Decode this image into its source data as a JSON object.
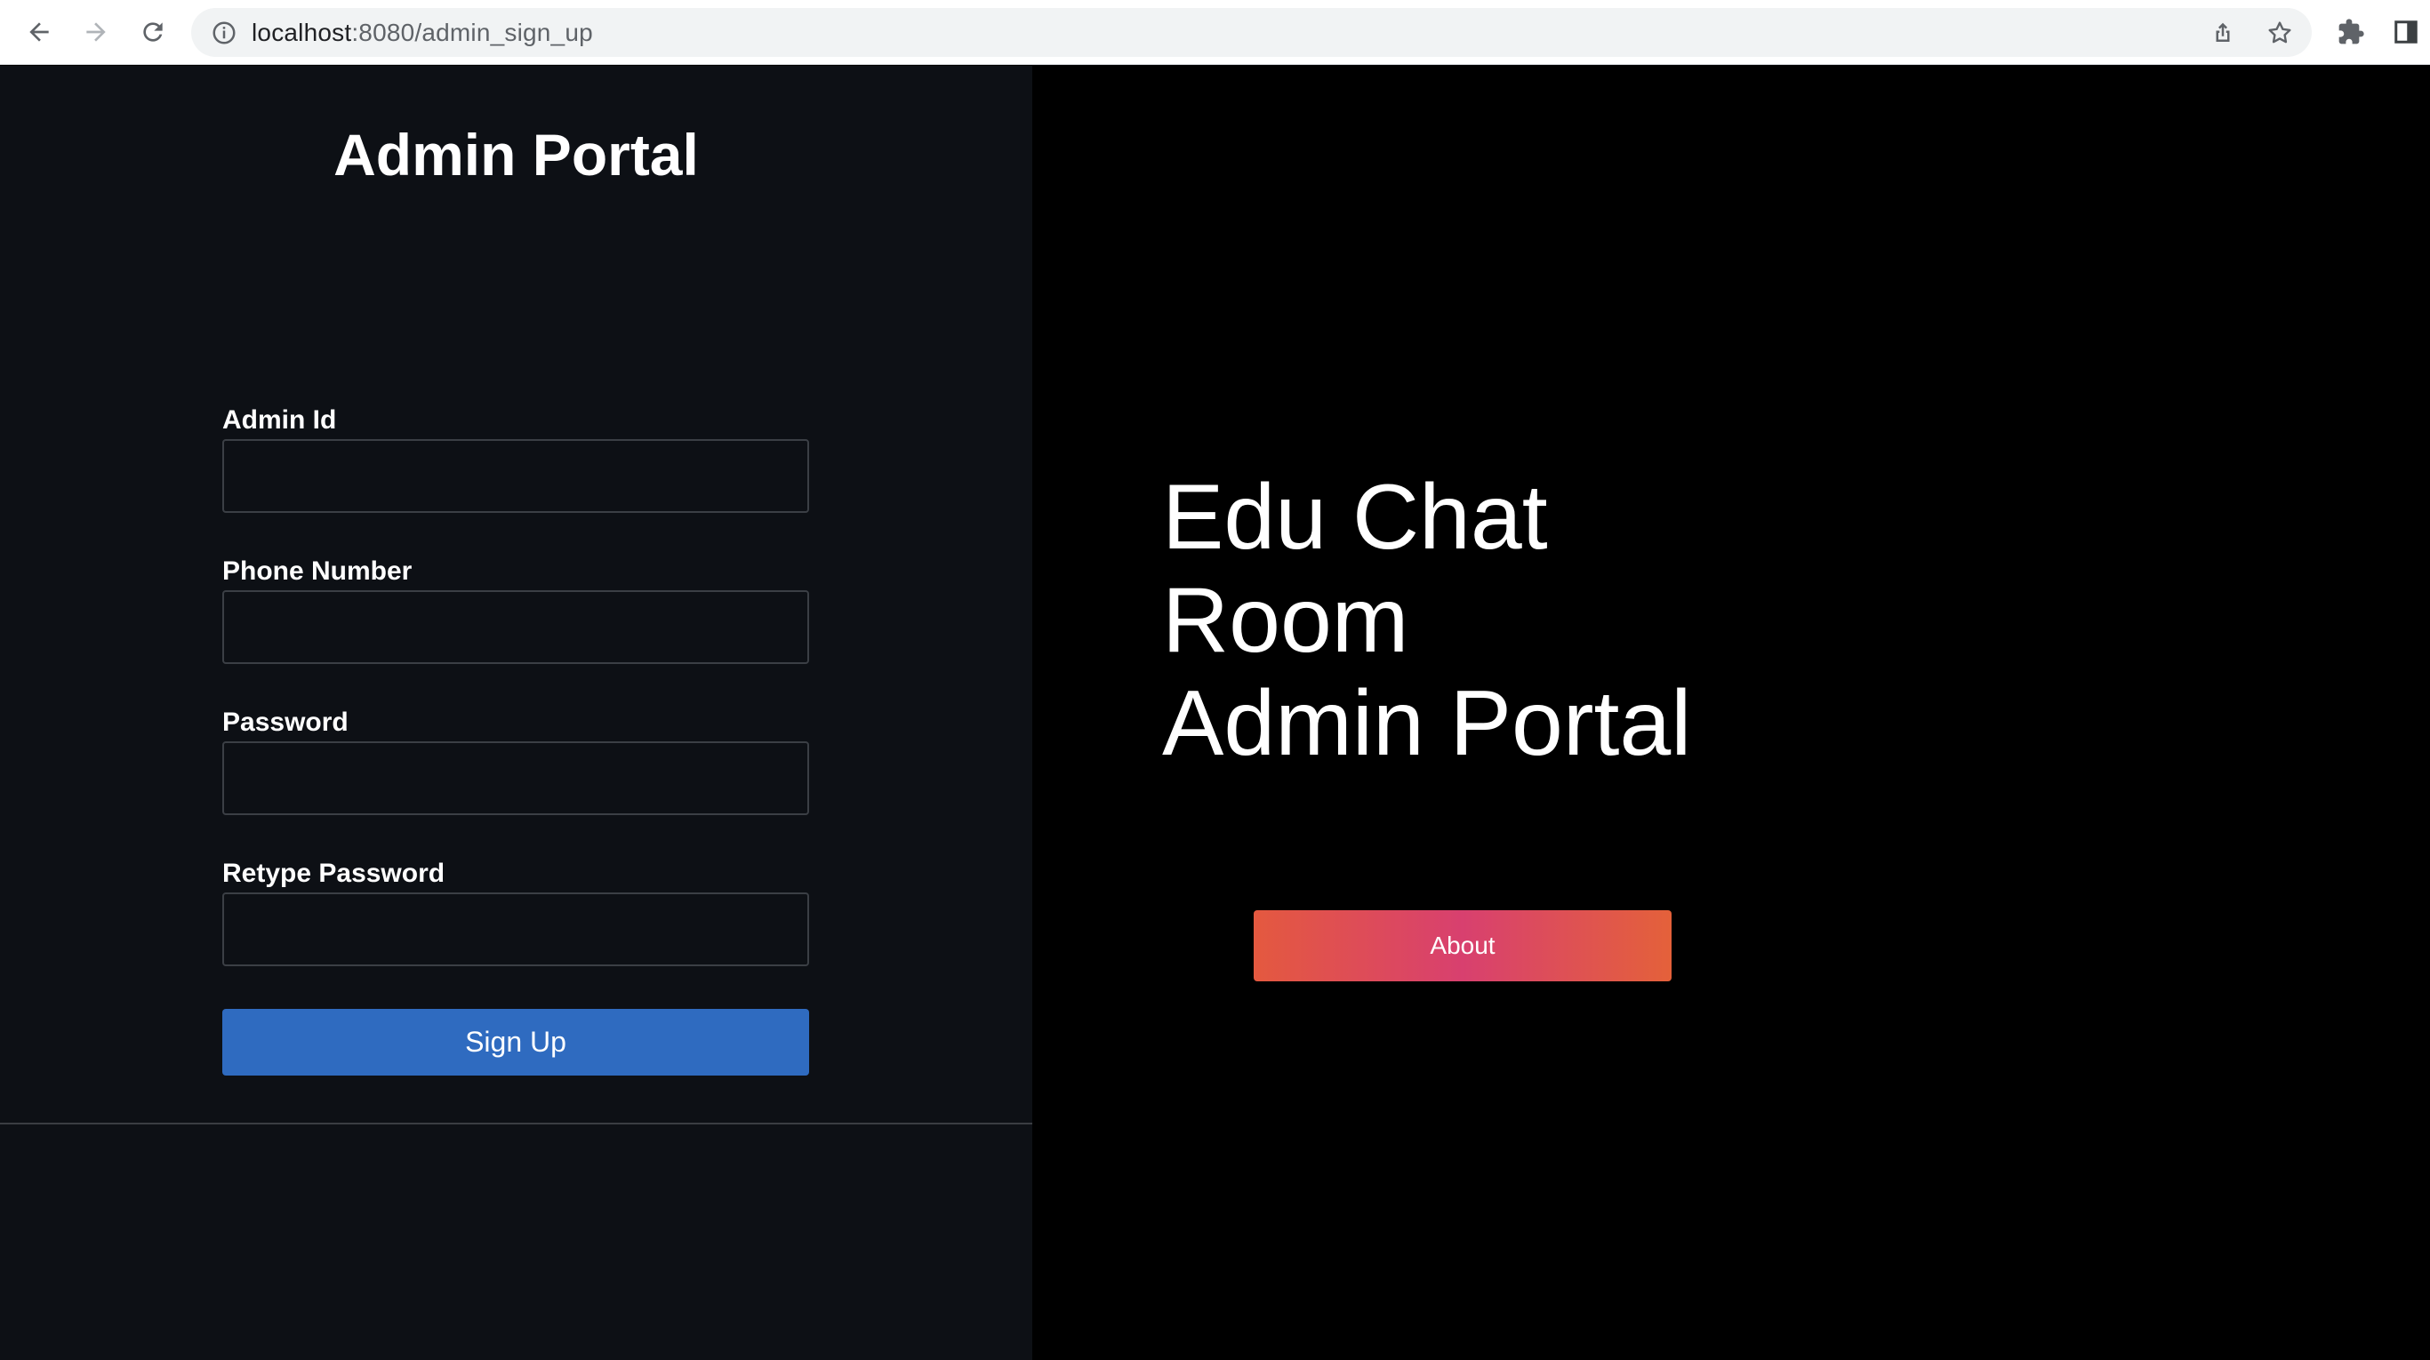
{
  "browser": {
    "url_host": "localhost",
    "url_path": ":8080/admin_sign_up"
  },
  "left": {
    "title": "Admin Portal",
    "fields": [
      {
        "label": "Admin Id",
        "value": ""
      },
      {
        "label": "Phone Number",
        "value": ""
      },
      {
        "label": "Password",
        "value": ""
      },
      {
        "label": "Retype Password",
        "value": ""
      }
    ],
    "signup_label": "Sign Up"
  },
  "right": {
    "hero_lines": [
      "Edu Chat",
      "Room",
      "Admin Portal"
    ],
    "about_label": "About"
  },
  "colors": {
    "left_bg": "#0d1015",
    "right_bg": "#000000",
    "signup_btn": "#2f6bc0",
    "about_gradient": [
      "#e4593f",
      "#d8406f",
      "#e4613a"
    ]
  },
  "icons": [
    "back-arrow-icon",
    "forward-arrow-icon",
    "reload-icon",
    "info-icon",
    "share-icon",
    "star-icon",
    "extensions-puzzle-icon",
    "side-panel-icon"
  ]
}
